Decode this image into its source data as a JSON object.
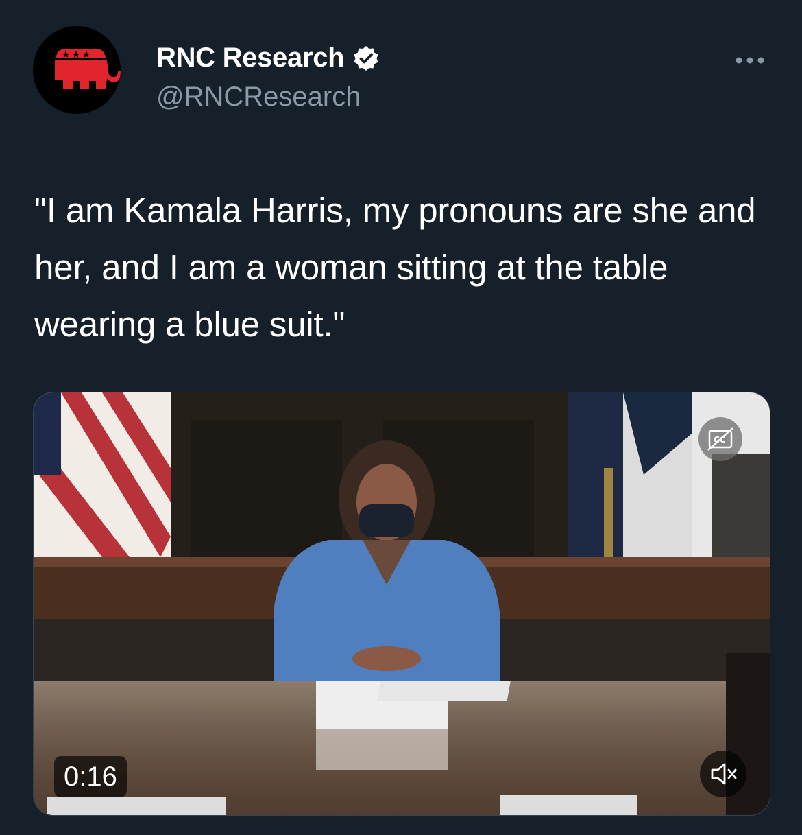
{
  "author": {
    "display_name": "RNC Research",
    "handle": "@RNCResearch",
    "verified": true,
    "avatar_icon": "republican-elephant-logo"
  },
  "tweet": {
    "text": "\"I am Kamala Harris, my pronouns are she and her, and I am a woman sitting at the table wearing a blue suit.\""
  },
  "media": {
    "type": "video",
    "duration": "0:16",
    "cc_icon": "closed-captions-off-icon",
    "mute_icon": "speaker-muted-icon"
  },
  "colors": {
    "background": "#15202b",
    "handle_gray": "#8b98a5",
    "verified_badge": "#ffffff",
    "logo_red": "#e0252c"
  },
  "icons": {
    "more": "more-dots-icon",
    "verified": "verified-badge-icon"
  }
}
